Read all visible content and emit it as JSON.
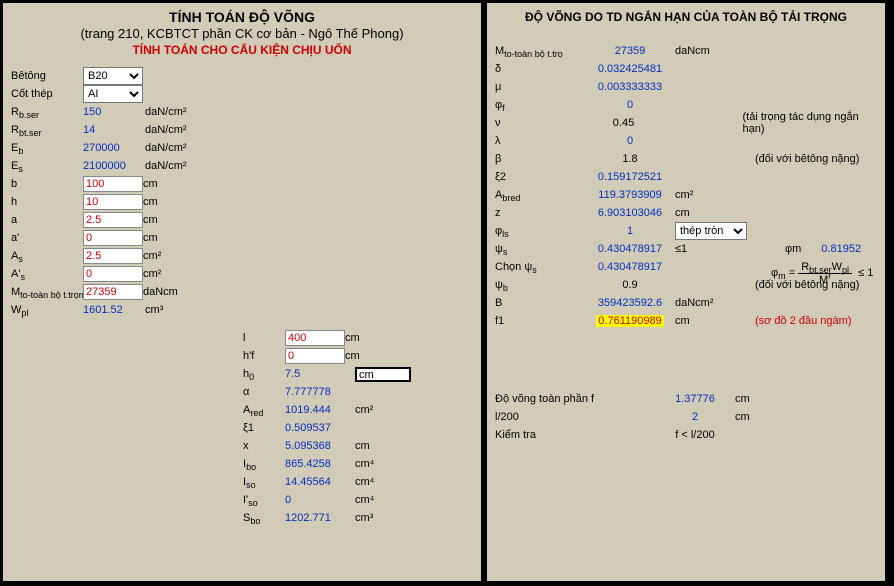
{
  "left": {
    "title_main": "TÍNH TOÁN ĐỘ VÕNG",
    "title_sub": "(trang 210, KCBTCT phần CK cơ bản - Ngô Thế Phong)",
    "title_red": "TÍNH TOÁN CHO CẤU KIỆN CHỊU UỐN",
    "rows": [
      {
        "label": "Bêtông",
        "kind": "select",
        "value": "B20"
      },
      {
        "label": "Cốt thép",
        "kind": "select",
        "value": "AI"
      },
      {
        "label_html": "R<sub>b.ser</sub>",
        "value": "150",
        "cls": "blue",
        "unit": "daN/cm²"
      },
      {
        "label_html": "R<sub>bt.ser</sub>",
        "value": "14",
        "cls": "blue",
        "unit": "daN/cm²"
      },
      {
        "label_html": "E<sub>b</sub>",
        "value": "270000",
        "cls": "blue",
        "unit": "daN/cm²"
      },
      {
        "label_html": "E<sub>s</sub>",
        "value": "2100000",
        "cls": "blue",
        "unit": "daN/cm²"
      },
      {
        "label": "b",
        "kind": "input",
        "value": "100",
        "unit": "cm"
      },
      {
        "label": "h",
        "kind": "input",
        "value": "10",
        "unit": "cm"
      },
      {
        "label": "a",
        "kind": "input",
        "value": "2.5",
        "unit": "cm"
      },
      {
        "label": "a'",
        "kind": "input",
        "value": "0",
        "unit": "cm"
      },
      {
        "label_html": "A<sub>s</sub>",
        "kind": "input",
        "value": "2.5",
        "unit": "cm²"
      },
      {
        "label_html": "A'<sub>s</sub>",
        "kind": "input",
        "value": "0",
        "unit": "cm²"
      },
      {
        "label_html": "M<sub>to-toàn bộ t.trọng</sub>",
        "kind": "input",
        "value": "27359",
        "unit": "daNcm"
      },
      {
        "label_html": "W<sub>pl</sub>",
        "value": "1601.52",
        "cls": "blue",
        "unit": "cm³"
      }
    ],
    "col2": [
      {
        "label": "l",
        "kind": "input",
        "value": "400",
        "unit": "cm"
      },
      {
        "label": "h'f",
        "kind": "input",
        "value": "0",
        "unit": "cm"
      },
      {
        "label_html": "h<sub>0</sub>",
        "value": "7.5",
        "cls": "blue",
        "unit_kind": "box",
        "unit": "cm"
      },
      {
        "label": "α",
        "value": "7.777778",
        "cls": "blue",
        "unit": ""
      },
      {
        "label_html": "A<sub>red</sub>",
        "value": "1019.444",
        "cls": "blue",
        "unit": "cm²"
      },
      {
        "label": "ξ1",
        "value": "0.509537",
        "cls": "blue",
        "unit": ""
      },
      {
        "label": "x",
        "value": "5.095368",
        "cls": "blue",
        "unit": "cm"
      },
      {
        "label_html": "I<sub>bo</sub>",
        "value": "865.4258",
        "cls": "blue",
        "unit": "cm⁴"
      },
      {
        "label_html": "I<sub>so</sub>",
        "value": "14.45564",
        "cls": "blue",
        "unit": "cm⁴"
      },
      {
        "label_html": "I'<sub>so</sub>",
        "value": "0",
        "cls": "blue",
        "unit": "cm⁴"
      },
      {
        "label_html": "S<sub>bo</sub>",
        "value": "1202.771",
        "cls": "blue",
        "unit": "cm³"
      }
    ]
  },
  "right": {
    "title": "ĐỘ VÕNG DO TD NGẮN HẠN CỦA TOÀN BỘ TẢI TRỌNG",
    "rows": [
      {
        "label_html": "M<sub>to-toàn bộ t.trọ</sub>",
        "value": "27359",
        "cls": "blue",
        "unit": "daNcm"
      },
      {
        "label": "δ",
        "value": "0.032425481",
        "cls": "blue",
        "unit": ""
      },
      {
        "label": "μ",
        "value": "0.003333333",
        "cls": "blue",
        "unit": ""
      },
      {
        "label_html": "φ<sub>f</sub>",
        "value": "0",
        "cls": "blue",
        "unit": ""
      },
      {
        "label": "ν",
        "value": "0.45",
        "cls": "",
        "unit": "",
        "note": "(tải trọng tác dụng ngắn hạn)"
      },
      {
        "label": "λ",
        "value": "0",
        "cls": "blue",
        "unit": ""
      },
      {
        "label": "β",
        "value": "1.8",
        "cls": "",
        "unit": "",
        "note": "(đối với bêtông nặng)"
      },
      {
        "label": "ξ2",
        "value": "0.159172521",
        "cls": "blue",
        "unit": ""
      },
      {
        "label_html": "A<sub>bred</sub>",
        "value": "119.3793909",
        "cls": "blue",
        "unit": "cm²"
      },
      {
        "label": "z",
        "value": "6.903103046",
        "cls": "blue",
        "unit": "cm"
      },
      {
        "label_html": "φ<sub>ls</sub>",
        "value": "1",
        "kind": "select",
        "option": "thép tròn",
        "unit": ""
      },
      {
        "label_html": "ψ<sub>s</sub>",
        "value": "0.430478917",
        "cls": "blue",
        "unit": "≤1",
        "extra_lbl": "φm",
        "extra_val": "0.81952"
      },
      {
        "label_html": "Chọn ψ<sub>s</sub>",
        "value": "0.430478917",
        "cls": "blue",
        "unit": ""
      },
      {
        "label_html": "ψ<sub>b</sub>",
        "value": "0.9",
        "cls": "",
        "unit": "",
        "note": "(đối với bêtông nặng)"
      },
      {
        "label": "B",
        "value": "359423592.6",
        "cls": "blue",
        "unit": "daNcm²"
      },
      {
        "label": "f1",
        "value": "0.761190989",
        "cls": "red",
        "highlight": true,
        "unit": "cm",
        "note": "(sơ đồ 2 đầu ngàm)",
        "note_cls": "red"
      }
    ],
    "summary": [
      {
        "label": "Độ võng toàn phần f",
        "value": "1.37776",
        "cls": "blue",
        "unit": "cm"
      },
      {
        "label": "l/200",
        "value": "2",
        "cls": "blue",
        "unit": "cm"
      },
      {
        "label": "Kiểm tra",
        "value": "f < l/200",
        "cls": "",
        "unit": ""
      }
    ],
    "formula": {
      "lhs": "φ",
      "sub": "m",
      "eq": "=",
      "num": "R<sub>bt.ser</sub>W<sub>pl</sub>",
      "den": "M<sup>r</sup>",
      "tail": "≤ 1"
    },
    "phi_m_label": "φm",
    "phi_m_value": "0.81952"
  }
}
